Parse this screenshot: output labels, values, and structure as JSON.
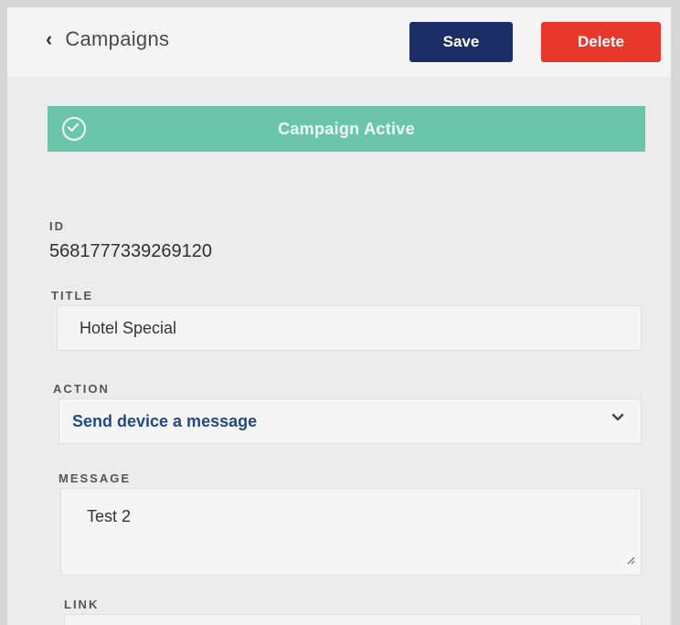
{
  "header": {
    "back_label": "Campaigns",
    "save_label": "Save",
    "delete_label": "Delete"
  },
  "status": {
    "text": "Campaign Active",
    "color": "#6bc6a9"
  },
  "form": {
    "id_label": "ID",
    "id_value": "5681777339269120",
    "title_label": "TITLE",
    "title_value": "Hotel Special",
    "action_label": "ACTION",
    "action_value": "Send device a message",
    "message_label": "MESSAGE",
    "message_value": "Test 2",
    "link_label": "LINK"
  },
  "colors": {
    "save": "#1b2f66",
    "delete": "#e8382c",
    "select_text": "#1f4a8a"
  },
  "icons": {
    "back": "chevron-left-icon",
    "status": "check-circle-icon",
    "dropdown": "chevron-down-icon",
    "resize": "resize-handle-icon"
  }
}
